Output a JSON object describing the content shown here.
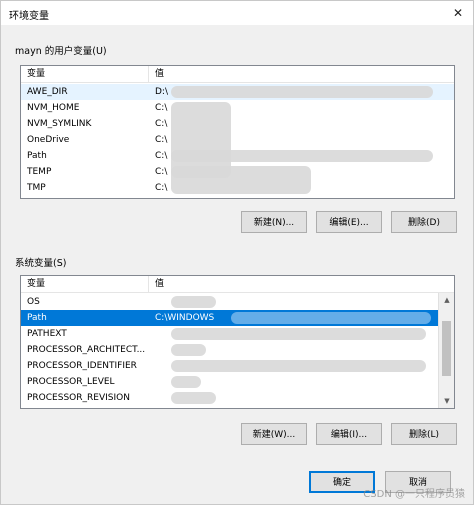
{
  "window": {
    "title": "环境变量",
    "close_glyph": "✕"
  },
  "user_group": {
    "label": "mayn 的用户变量(U)",
    "columns": [
      "变量",
      "值"
    ],
    "rows": [
      {
        "name": "AWE_DIR",
        "value": "D:\\"
      },
      {
        "name": "NVM_HOME",
        "value": "C:\\"
      },
      {
        "name": "NVM_SYMLINK",
        "value": "C:\\"
      },
      {
        "name": "OneDrive",
        "value": "C:\\"
      },
      {
        "name": "Path",
        "value": "C:\\"
      },
      {
        "name": "TEMP",
        "value": "C:\\"
      },
      {
        "name": "TMP",
        "value": "C:\\"
      }
    ],
    "buttons": {
      "new": "新建(N)...",
      "edit": "编辑(E)...",
      "delete": "删除(D)"
    }
  },
  "system_group": {
    "label": "系统变量(S)",
    "columns": [
      "变量",
      "值"
    ],
    "rows": [
      {
        "name": "OS",
        "value": ""
      },
      {
        "name": "Path",
        "value": "C:\\WINDOWS"
      },
      {
        "name": "PATHEXT",
        "value": ""
      },
      {
        "name": "PROCESSOR_ARCHITECT...",
        "value": ""
      },
      {
        "name": "PROCESSOR_IDENTIFIER",
        "value": ""
      },
      {
        "name": "PROCESSOR_LEVEL",
        "value": ""
      },
      {
        "name": "PROCESSOR_REVISION",
        "value": ""
      }
    ],
    "selected_index": 1,
    "buttons": {
      "new": "新建(W)...",
      "edit": "编辑(I)...",
      "delete": "删除(L)"
    }
  },
  "dialog_buttons": {
    "ok": "确定",
    "cancel": "取消"
  },
  "watermark": "CSDN @一只程序员猿",
  "colors": {
    "selection": "#0078d7",
    "window_bg": "#f0f0f0"
  }
}
